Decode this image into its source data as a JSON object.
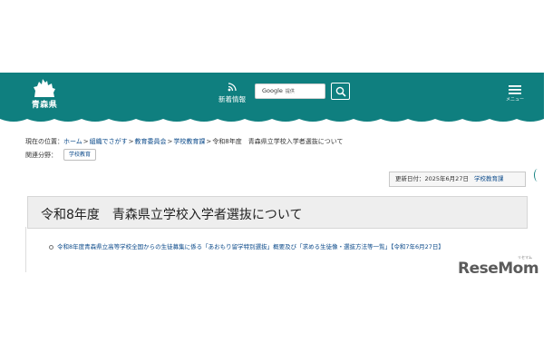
{
  "header": {
    "logo_text": "青森県",
    "news_label": "新着情報",
    "search": {
      "brand": "Google",
      "placeholder": "提供"
    },
    "menu_label": "メニュー"
  },
  "breadcrumb": {
    "current_prefix": "現在の位置：",
    "items": [
      {
        "label": "ホーム",
        "link": true
      },
      {
        "label": "組織でさがす",
        "link": true
      },
      {
        "label": "教育委員会",
        "link": true
      },
      {
        "label": "学校教育課",
        "link": true
      },
      {
        "label": "令和8年度　青森県立学校入学者選抜について",
        "link": false
      }
    ],
    "separator": ">"
  },
  "related": {
    "label": "関連分野：",
    "tag": "学校教育"
  },
  "update": {
    "text": "更新日付：2025年6月27日",
    "department": "学校教育課"
  },
  "page": {
    "title": "令和8年度　青森県立学校入学者選抜について",
    "links": [
      {
        "text": "令和8年度青森県立高等学校全国からの生徒募集に係る「あおもり留学特別選抜」概要及び「求める生徒像・選抜方法等一覧」【令和7年6月27日】"
      }
    ]
  },
  "watermark": {
    "text": "ReseMom",
    "sub": "リセマム"
  },
  "colors": {
    "header": "#0f7f7f",
    "link": "#0b4a8a",
    "title_bg": "#eeeeee"
  }
}
